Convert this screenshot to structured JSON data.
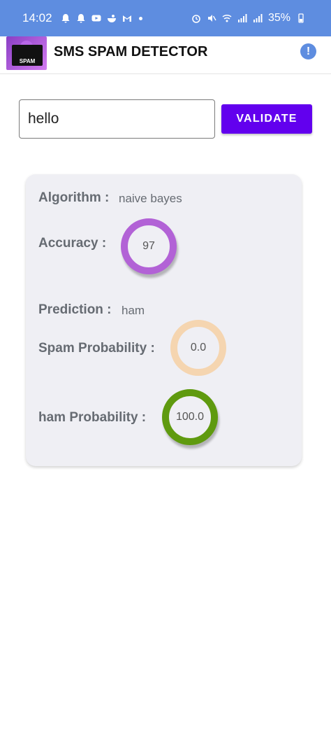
{
  "status_bar": {
    "time": "14:02",
    "battery": "35%",
    "icons": [
      "notification-bell-icon",
      "notification-bell-icon",
      "youtube-icon",
      "app-icon",
      "gmail-icon",
      "alarm-icon",
      "mute-icon",
      "wifi-icon",
      "signal-icon",
      "signal-icon",
      "battery-icon"
    ]
  },
  "app_bar": {
    "title": "SMS SPAM DETECTOR",
    "logo_text": "SPAM",
    "info_icon": "info-icon",
    "info_glyph": "!"
  },
  "input": {
    "value": "hello",
    "placeholder": ""
  },
  "validate_button": {
    "label": "VALIDATE",
    "color": "#6200ee"
  },
  "result": {
    "algorithm": {
      "label": "Algorithm :",
      "value": "naive bayes"
    },
    "accuracy": {
      "label": "Accuracy :",
      "value": "97",
      "ring_color": "#b262d6"
    },
    "prediction": {
      "label": "Prediction :",
      "value": "ham"
    },
    "spam_probability": {
      "label": "Spam Probability :",
      "value": "0.0",
      "ring_color": "#f5d5b0"
    },
    "ham_probability": {
      "label": "ham Probability :",
      "value": "100.0",
      "ring_color": "#5f9a0f"
    }
  },
  "colors": {
    "status_bar": "#5e8de0",
    "card_background": "#efeff4",
    "label_text": "#666b72"
  }
}
